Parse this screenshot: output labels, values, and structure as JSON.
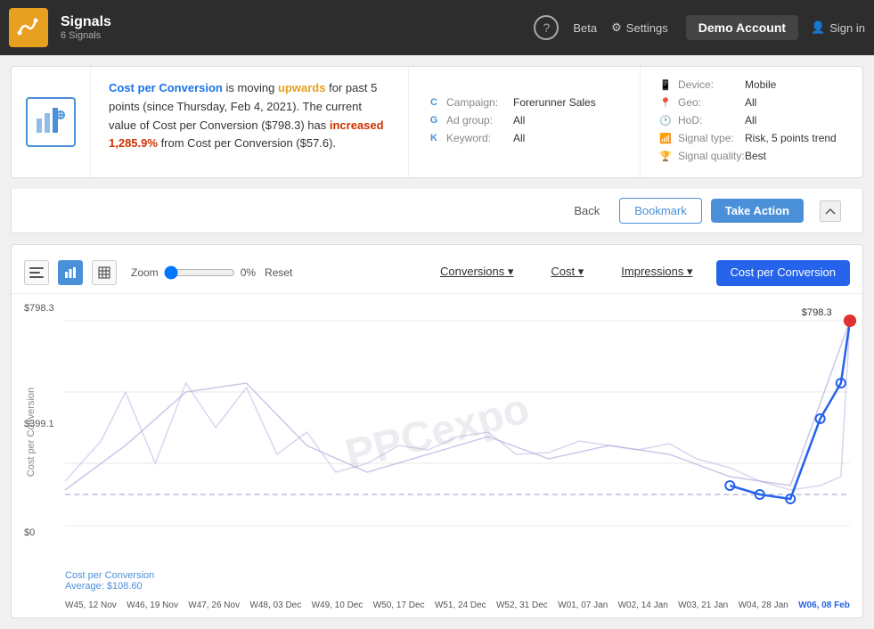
{
  "header": {
    "logo_icon": "signal-waves",
    "title": "Signals",
    "subtitle": "6 Signals",
    "help_label": "?",
    "beta_label": "Beta",
    "settings_label": "Settings",
    "account_label": "Demo Account",
    "signin_label": "Sign in"
  },
  "signal": {
    "metric_link": "Cost per Conversion",
    "direction": "upwards",
    "period": "past 5 points (since Thursday, Feb 4, 2021).",
    "current_label": "The current value of Cost per Conversion ($798.3) has",
    "change": "increased 1,285.9%",
    "from_text": "from Cost per Conversion ($57.6).",
    "campaign_label": "Campaign:",
    "campaign_value": "Forerunner Sales",
    "adgroup_label": "Ad group:",
    "adgroup_value": "All",
    "keyword_label": "Keyword:",
    "keyword_value": "All",
    "device_label": "Device:",
    "device_value": "Mobile",
    "geo_label": "Geo:",
    "geo_value": "All",
    "hod_label": "HoD:",
    "hod_value": "All",
    "signal_type_label": "Signal type:",
    "signal_type_value": "Risk, 5 points trend",
    "signal_quality_label": "Signal quality:",
    "signal_quality_value": "Best"
  },
  "action_bar": {
    "back_label": "Back",
    "bookmark_label": "Bookmark",
    "take_action_label": "Take Action"
  },
  "chart": {
    "zoom_label": "Zoom",
    "zoom_value": "0%",
    "reset_label": "Reset",
    "tabs": [
      {
        "label": "Conversions ▾",
        "active": false
      },
      {
        "label": "Cost ▾",
        "active": false
      },
      {
        "label": "Impressions ▾",
        "active": false
      },
      {
        "label": "Cost per Conversion",
        "active": true
      }
    ],
    "y_axis_label": "Cost per Conversion",
    "watermark": "PPCexpo",
    "y_values": [
      "$798.3",
      "$399.1",
      "$0"
    ],
    "avg_label": "Cost per Conversion",
    "avg_value": "Average: $108.60",
    "peak_value": "$798.3",
    "x_labels": [
      "W45, 12 Nov",
      "W46, 19 Nov",
      "W47, 26 Nov",
      "W48, 03 Dec",
      "W49, 10 Dec",
      "W50, 17 Dec",
      "W51, 24 Dec",
      "W52, 31 Dec",
      "W01, 07 Jan",
      "W02, 14 Jan",
      "W03, 21 Jan",
      "W04, 28 Jan",
      "W06, 08 Feb"
    ]
  }
}
